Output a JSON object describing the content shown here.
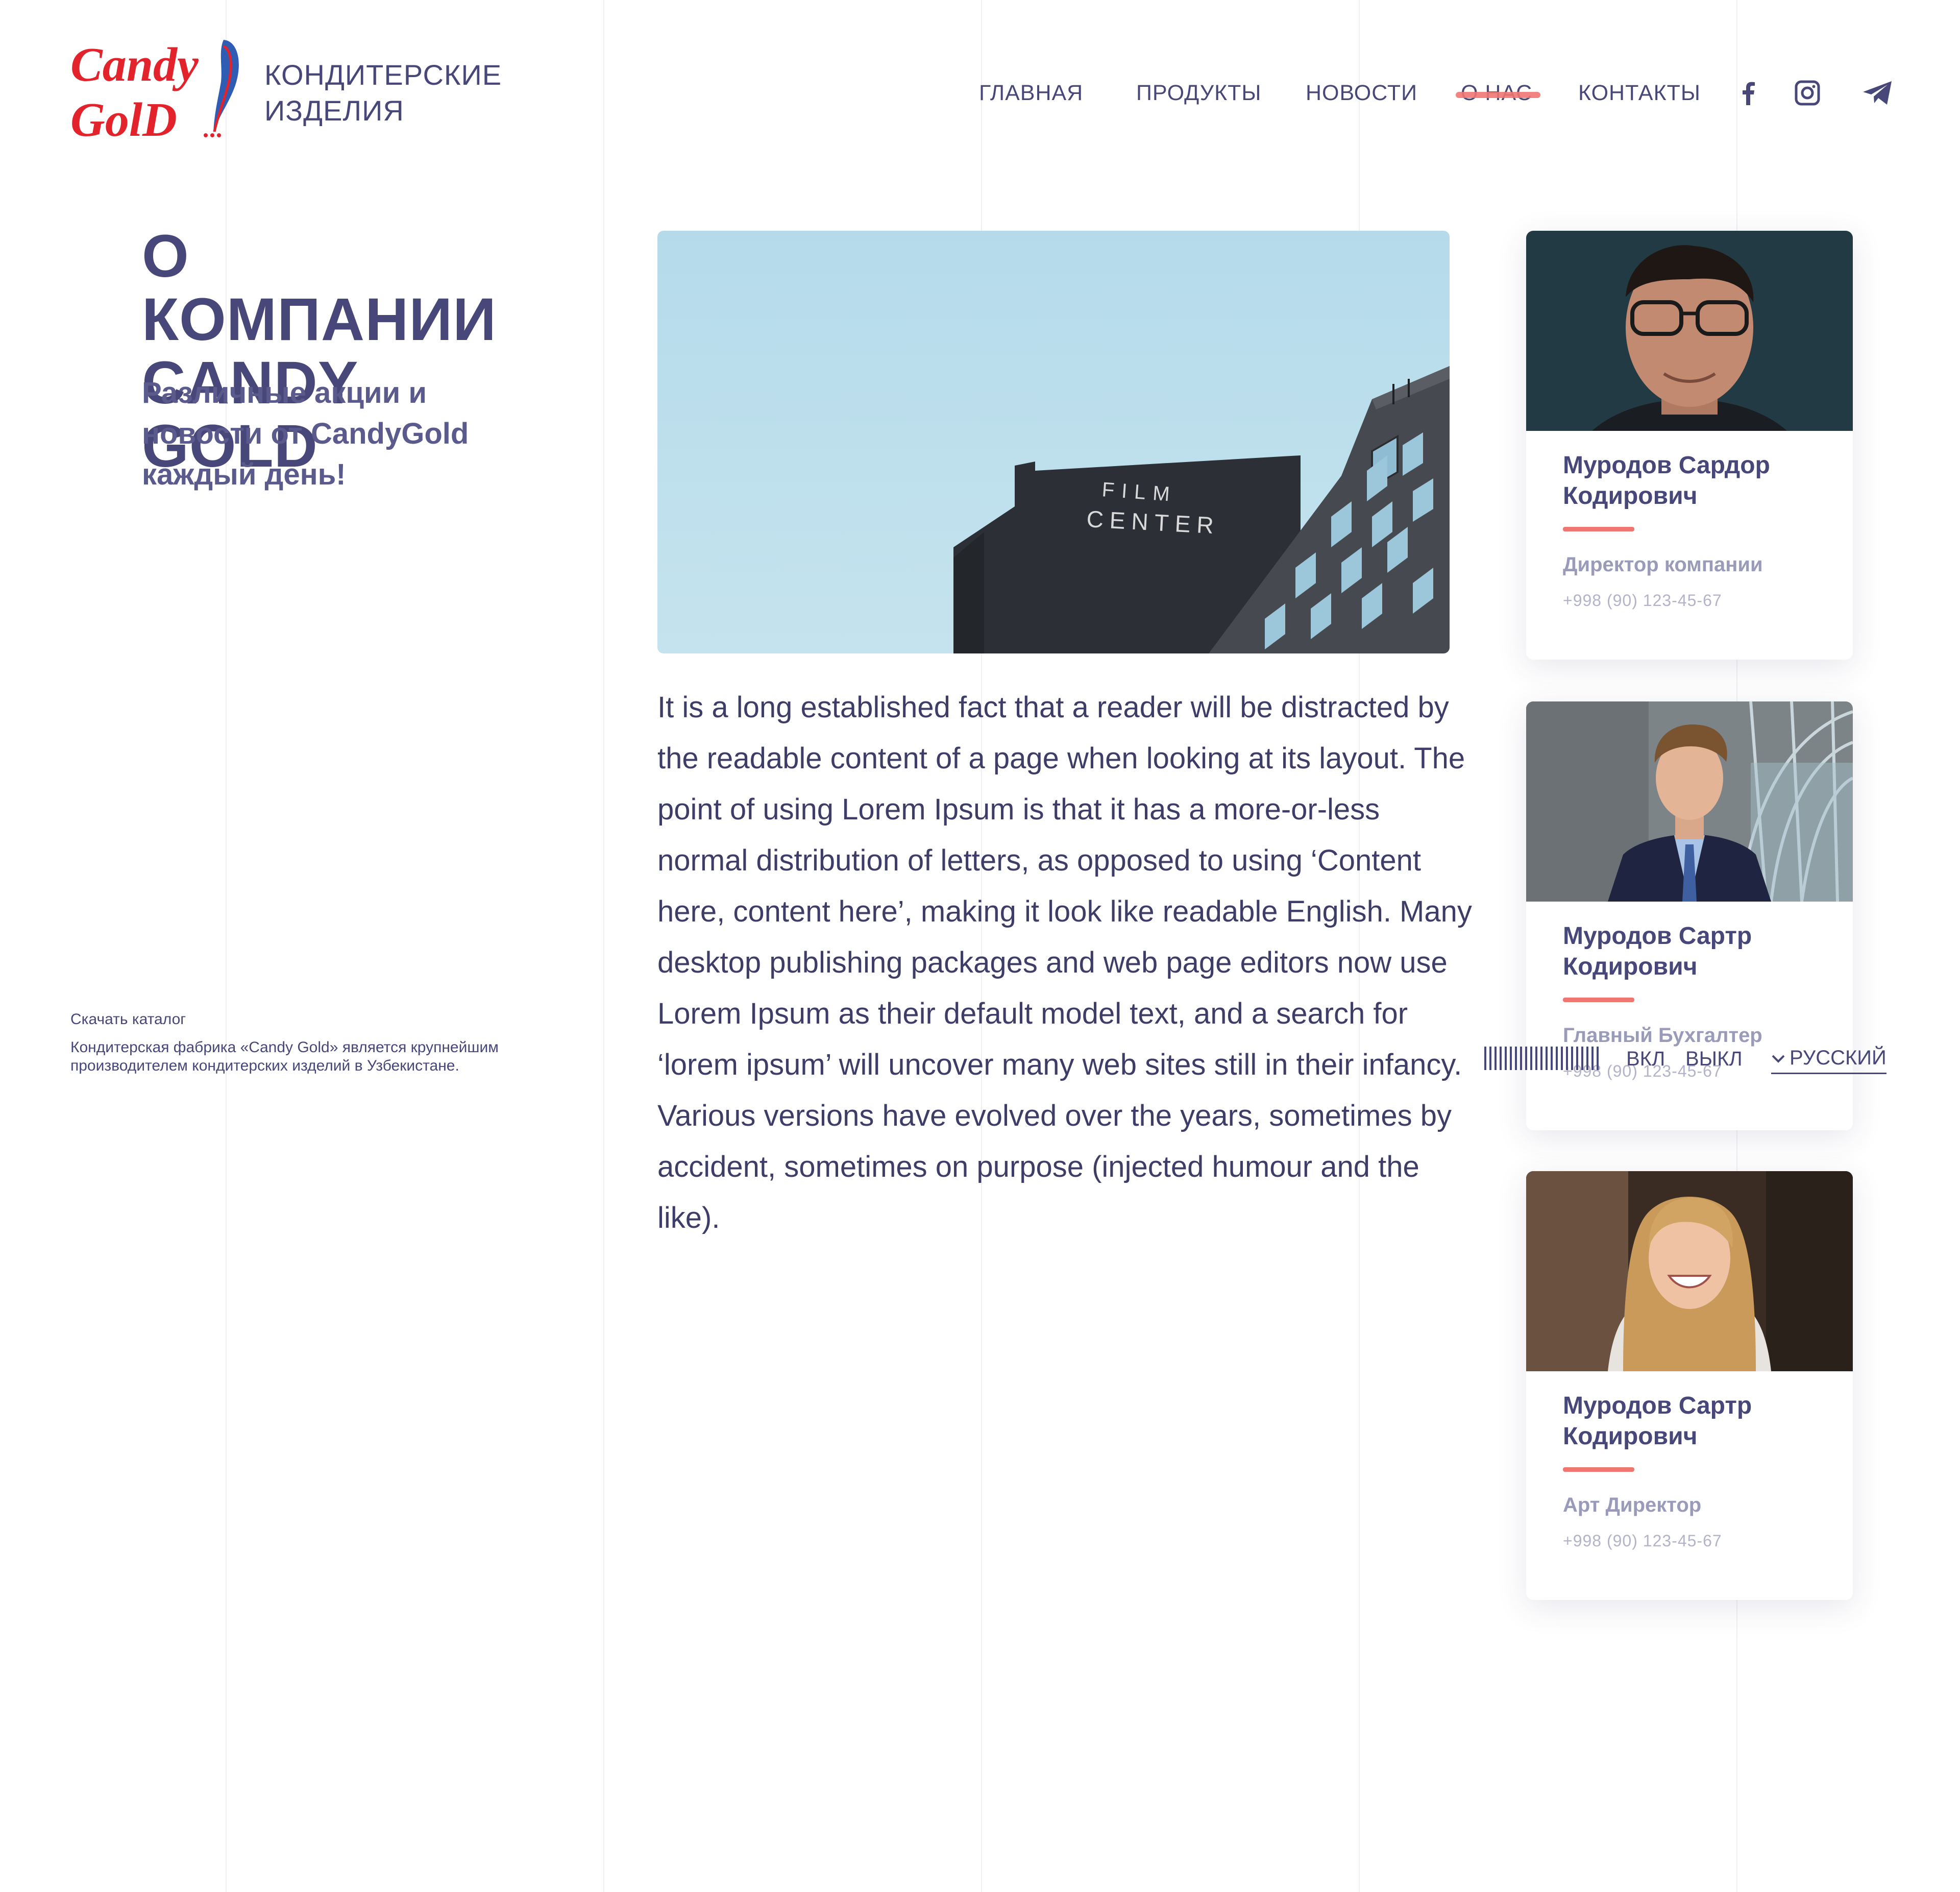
{
  "brand": {
    "logo_line1": "Candy",
    "logo_line2": "GolD",
    "title_line1": "КОНДИТЕРСКИЕ",
    "title_line2": "ИЗДЕЛИЯ"
  },
  "nav": {
    "items": [
      {
        "label": "ГЛАВНАЯ"
      },
      {
        "label": "ПРОДУКТЫ"
      },
      {
        "label": "НОВОСТИ"
      },
      {
        "label": "О НАС"
      },
      {
        "label": "КОНТАКТЫ"
      }
    ],
    "active_index": 3,
    "social": [
      "facebook-icon",
      "instagram-icon",
      "telegram-icon"
    ]
  },
  "page": {
    "title_line1": "О КОМПАНИИ",
    "title_line2": "CANDY GOLD",
    "subtitle": "Различные акции и новости от CandyGold каждый день!",
    "catalog_link": "Скачать каталог",
    "company_description": "Кондитерская фабрика «Candy Gold» является крупнейшим производителем кондитерских изделий в Узбекистане."
  },
  "hero": {
    "sign_line1": "FILM",
    "sign_line2": "CENTER"
  },
  "article": {
    "text": "It is a long established fact that a reader will be distracted by the readable content of a page when looking at its layout. The point of using Lorem Ipsum is that it has a more-or-less normal distribution of letters, as opposed to using ‘Content here, content here’, making it look like readable English. Many desktop publishing packages and web page editors now use Lorem Ipsum as their default model text, and a search for ‘lorem ipsum’ will uncover many web sites still in their infancy. Various versions have evolved over the years, sometimes by accident, sometimes on purpose (injected humour and the like)."
  },
  "staff": [
    {
      "name": "Муродов Сардор Кодирович",
      "role": "Директор компании",
      "phone": "+998 (90) 123-45-67"
    },
    {
      "name": "Муродов Сартр Кодирович",
      "role": "Главный Бухгалтер",
      "phone": "+998 (90) 123-45-67"
    },
    {
      "name": "Муродов Сартр Кодирович",
      "role": "Арт Директор",
      "phone": "+998 (90) 123-45-67"
    }
  ],
  "controls": {
    "toggle_on": "ВКЛ",
    "toggle_off": "ВЫКЛ",
    "language": "РУССКИЙ"
  },
  "colors": {
    "primary": "#47477a",
    "accent": "#f07672",
    "logo_red": "#e3232b",
    "muted": "#9a9ab9"
  }
}
